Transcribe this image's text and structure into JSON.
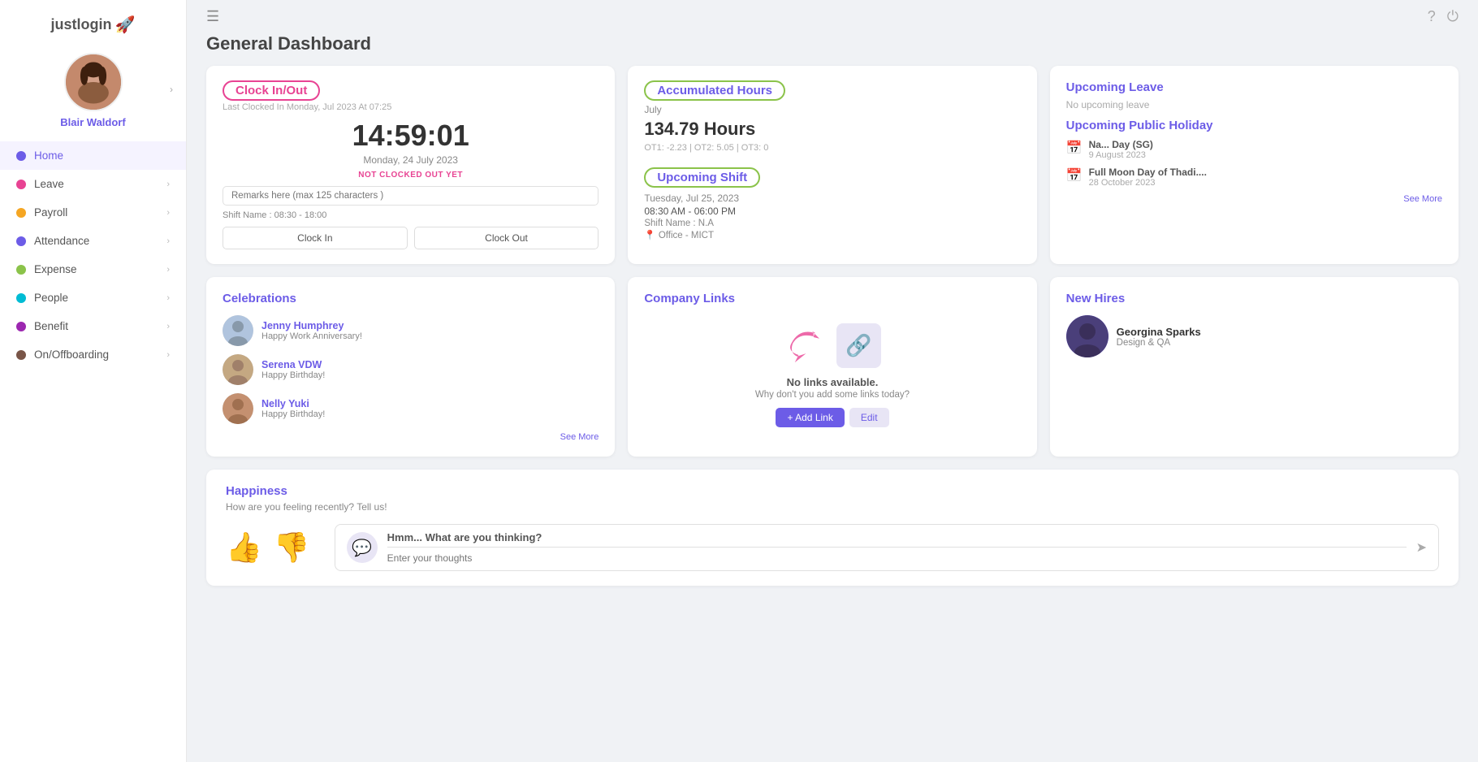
{
  "app": {
    "logo_text": "justlogin",
    "hamburger_label": "☰"
  },
  "sidebar": {
    "username": "Blair Waldorf",
    "nav_items": [
      {
        "id": "home",
        "label": "Home",
        "color": "#6c5ce7",
        "active": true
      },
      {
        "id": "leave",
        "label": "Leave",
        "color": "#e84393"
      },
      {
        "id": "payroll",
        "label": "Payroll",
        "color": "#f5a623"
      },
      {
        "id": "attendance",
        "label": "Attendance",
        "color": "#6c5ce7"
      },
      {
        "id": "expense",
        "label": "Expense",
        "color": "#8bc34a"
      },
      {
        "id": "people",
        "label": "People",
        "color": "#00bcd4"
      },
      {
        "id": "benefit",
        "label": "Benefit",
        "color": "#9c27b0"
      },
      {
        "id": "onoffboarding",
        "label": "On/Offboarding",
        "color": "#795548"
      }
    ]
  },
  "page": {
    "title": "General Dashboard"
  },
  "clock_card": {
    "title": "Clock In/Out",
    "last_clocked": "Last Clocked In Monday, Jul 2023 At 07:25",
    "time": "14:59:01",
    "date": "Monday, 24 July 2023",
    "not_clocked": "NOT CLOCKED OUT YET",
    "remarks_placeholder": "Remarks here (max 125 characters )",
    "shift_label": "Shift Name : 08:30 - 18:00",
    "btn_clock_in": "Clock In",
    "btn_clock_out": "Clock Out"
  },
  "accumulated_card": {
    "title": "Accumulated Hours",
    "month": "July",
    "hours": "134.79 Hours",
    "ot_details": "OT1: -2.23 | OT2: 5.05 | OT3: 0"
  },
  "upcoming_shift_card": {
    "title": "Upcoming Shift",
    "date": "Tuesday, Jul 25, 2023",
    "time": "08:30 AM - 06:00 PM",
    "shift_name": "Shift Name : N.A",
    "office": "Office - MICT"
  },
  "upcoming_leave_card": {
    "title": "Upcoming Leave",
    "none_text": "No upcoming leave"
  },
  "upcoming_holiday_card": {
    "title": "Upcoming Public Holiday",
    "holidays": [
      {
        "name": "Na... Day (SG)",
        "date": "9 August 2023"
      },
      {
        "name": "Full Moon Day of Thadi....",
        "date": "28 October 2023"
      }
    ],
    "see_more": "See More"
  },
  "celebrations_card": {
    "title": "Celebrations",
    "items": [
      {
        "name": "Jenny Humphrey",
        "message": "Happy Work Anniversary!"
      },
      {
        "name": "Serena VDW",
        "message": "Happy Birthday!"
      },
      {
        "name": "Nelly Yuki",
        "message": "Happy Birthday!"
      }
    ],
    "see_more": "See More"
  },
  "company_links_card": {
    "title": "Company Links",
    "no_links_text": "No links available.",
    "no_links_sub": "Why don't you add some links today?",
    "btn_add": "+ Add Link",
    "btn_edit": "Edit"
  },
  "new_hires_card": {
    "title": "New Hires",
    "hires": [
      {
        "name": "Georgina Sparks",
        "dept": "Design & QA"
      }
    ]
  },
  "happiness_card": {
    "title": "Happiness",
    "subtitle": "How are you feeling recently? Tell us!",
    "hmm_text": "Hmm... What are you thinking?",
    "input_placeholder": "Enter your thoughts"
  }
}
